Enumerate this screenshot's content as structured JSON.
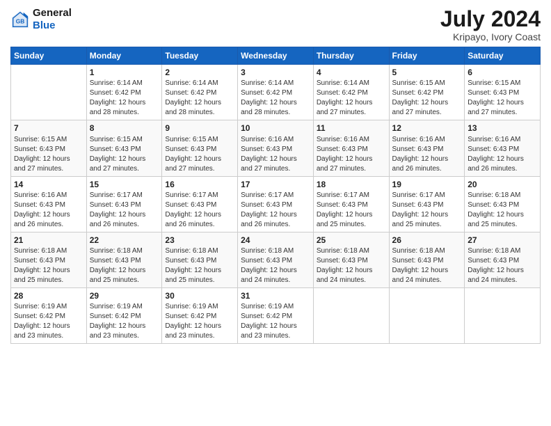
{
  "header": {
    "logo_line1": "General",
    "logo_line2": "Blue",
    "title": "July 2024",
    "subtitle": "Kripayo, Ivory Coast"
  },
  "days_of_week": [
    "Sunday",
    "Monday",
    "Tuesday",
    "Wednesday",
    "Thursday",
    "Friday",
    "Saturday"
  ],
  "weeks": [
    [
      {
        "day": "",
        "info": ""
      },
      {
        "day": "1",
        "info": "Sunrise: 6:14 AM\nSunset: 6:42 PM\nDaylight: 12 hours\nand 28 minutes."
      },
      {
        "day": "2",
        "info": "Sunrise: 6:14 AM\nSunset: 6:42 PM\nDaylight: 12 hours\nand 28 minutes."
      },
      {
        "day": "3",
        "info": "Sunrise: 6:14 AM\nSunset: 6:42 PM\nDaylight: 12 hours\nand 28 minutes."
      },
      {
        "day": "4",
        "info": "Sunrise: 6:14 AM\nSunset: 6:42 PM\nDaylight: 12 hours\nand 27 minutes."
      },
      {
        "day": "5",
        "info": "Sunrise: 6:15 AM\nSunset: 6:42 PM\nDaylight: 12 hours\nand 27 minutes."
      },
      {
        "day": "6",
        "info": "Sunrise: 6:15 AM\nSunset: 6:43 PM\nDaylight: 12 hours\nand 27 minutes."
      }
    ],
    [
      {
        "day": "7",
        "info": "Sunrise: 6:15 AM\nSunset: 6:43 PM\nDaylight: 12 hours\nand 27 minutes."
      },
      {
        "day": "8",
        "info": "Sunrise: 6:15 AM\nSunset: 6:43 PM\nDaylight: 12 hours\nand 27 minutes."
      },
      {
        "day": "9",
        "info": "Sunrise: 6:15 AM\nSunset: 6:43 PM\nDaylight: 12 hours\nand 27 minutes."
      },
      {
        "day": "10",
        "info": "Sunrise: 6:16 AM\nSunset: 6:43 PM\nDaylight: 12 hours\nand 27 minutes."
      },
      {
        "day": "11",
        "info": "Sunrise: 6:16 AM\nSunset: 6:43 PM\nDaylight: 12 hours\nand 27 minutes."
      },
      {
        "day": "12",
        "info": "Sunrise: 6:16 AM\nSunset: 6:43 PM\nDaylight: 12 hours\nand 26 minutes."
      },
      {
        "day": "13",
        "info": "Sunrise: 6:16 AM\nSunset: 6:43 PM\nDaylight: 12 hours\nand 26 minutes."
      }
    ],
    [
      {
        "day": "14",
        "info": "Sunrise: 6:16 AM\nSunset: 6:43 PM\nDaylight: 12 hours\nand 26 minutes."
      },
      {
        "day": "15",
        "info": "Sunrise: 6:17 AM\nSunset: 6:43 PM\nDaylight: 12 hours\nand 26 minutes."
      },
      {
        "day": "16",
        "info": "Sunrise: 6:17 AM\nSunset: 6:43 PM\nDaylight: 12 hours\nand 26 minutes."
      },
      {
        "day": "17",
        "info": "Sunrise: 6:17 AM\nSunset: 6:43 PM\nDaylight: 12 hours\nand 26 minutes."
      },
      {
        "day": "18",
        "info": "Sunrise: 6:17 AM\nSunset: 6:43 PM\nDaylight: 12 hours\nand 25 minutes."
      },
      {
        "day": "19",
        "info": "Sunrise: 6:17 AM\nSunset: 6:43 PM\nDaylight: 12 hours\nand 25 minutes."
      },
      {
        "day": "20",
        "info": "Sunrise: 6:18 AM\nSunset: 6:43 PM\nDaylight: 12 hours\nand 25 minutes."
      }
    ],
    [
      {
        "day": "21",
        "info": "Sunrise: 6:18 AM\nSunset: 6:43 PM\nDaylight: 12 hours\nand 25 minutes."
      },
      {
        "day": "22",
        "info": "Sunrise: 6:18 AM\nSunset: 6:43 PM\nDaylight: 12 hours\nand 25 minutes."
      },
      {
        "day": "23",
        "info": "Sunrise: 6:18 AM\nSunset: 6:43 PM\nDaylight: 12 hours\nand 25 minutes."
      },
      {
        "day": "24",
        "info": "Sunrise: 6:18 AM\nSunset: 6:43 PM\nDaylight: 12 hours\nand 24 minutes."
      },
      {
        "day": "25",
        "info": "Sunrise: 6:18 AM\nSunset: 6:43 PM\nDaylight: 12 hours\nand 24 minutes."
      },
      {
        "day": "26",
        "info": "Sunrise: 6:18 AM\nSunset: 6:43 PM\nDaylight: 12 hours\nand 24 minutes."
      },
      {
        "day": "27",
        "info": "Sunrise: 6:18 AM\nSunset: 6:43 PM\nDaylight: 12 hours\nand 24 minutes."
      }
    ],
    [
      {
        "day": "28",
        "info": "Sunrise: 6:19 AM\nSunset: 6:42 PM\nDaylight: 12 hours\nand 23 minutes."
      },
      {
        "day": "29",
        "info": "Sunrise: 6:19 AM\nSunset: 6:42 PM\nDaylight: 12 hours\nand 23 minutes."
      },
      {
        "day": "30",
        "info": "Sunrise: 6:19 AM\nSunset: 6:42 PM\nDaylight: 12 hours\nand 23 minutes."
      },
      {
        "day": "31",
        "info": "Sunrise: 6:19 AM\nSunset: 6:42 PM\nDaylight: 12 hours\nand 23 minutes."
      },
      {
        "day": "",
        "info": ""
      },
      {
        "day": "",
        "info": ""
      },
      {
        "day": "",
        "info": ""
      }
    ]
  ]
}
